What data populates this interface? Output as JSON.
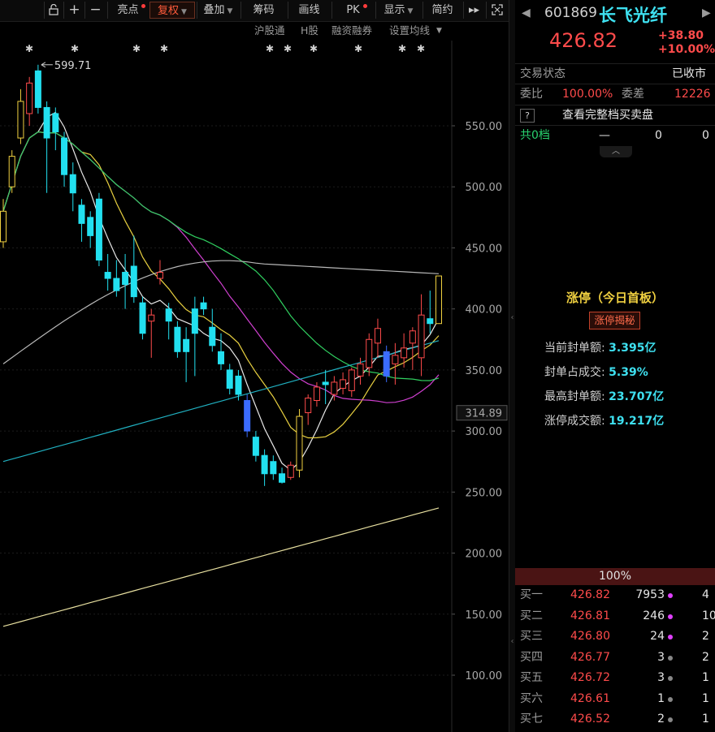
{
  "toolbar": {
    "items": [
      "亮点",
      "复权",
      "叠加",
      "筹码",
      "画线",
      "PK",
      "显示",
      "简约"
    ]
  },
  "sub_toolbar": [
    "沪股通",
    "H股",
    "融资融券",
    "设置均线"
  ],
  "chart": {
    "high_label": "599.71",
    "price_ticks": [
      "550.00",
      "500.00",
      "450.00",
      "400.00",
      "350.00",
      "314.89",
      "300.00",
      "250.00",
      "200.00",
      "150.00",
      "100.00"
    ]
  },
  "chart_data": {
    "type": "candlestick",
    "title": "",
    "y_ticks": [
      550,
      500,
      450,
      400,
      350,
      300,
      250,
      200,
      150,
      100
    ],
    "current_line": 314.89,
    "annotated_high": 599.71,
    "candles": [
      {
        "o": 455,
        "c": 480,
        "h": 490,
        "l": 450
      },
      {
        "o": 500,
        "c": 525,
        "h": 530,
        "l": 495
      },
      {
        "o": 540,
        "c": 570,
        "h": 580,
        "l": 535
      },
      {
        "o": 560,
        "c": 585,
        "h": 590,
        "l": 550
      },
      {
        "o": 595,
        "c": 565,
        "h": 600,
        "l": 560
      },
      {
        "o": 565,
        "c": 540,
        "h": 570,
        "l": 495
      },
      {
        "o": 560,
        "c": 545,
        "h": 565,
        "l": 530
      },
      {
        "o": 540,
        "c": 510,
        "h": 545,
        "l": 500
      },
      {
        "o": 510,
        "c": 495,
        "h": 520,
        "l": 480
      },
      {
        "o": 485,
        "c": 470,
        "h": 490,
        "l": 455
      },
      {
        "o": 475,
        "c": 460,
        "h": 480,
        "l": 450
      },
      {
        "o": 490,
        "c": 440,
        "h": 495,
        "l": 435
      },
      {
        "o": 430,
        "c": 425,
        "h": 445,
        "l": 415
      },
      {
        "o": 425,
        "c": 415,
        "h": 440,
        "l": 410
      },
      {
        "o": 430,
        "c": 420,
        "h": 445,
        "l": 400
      },
      {
        "o": 435,
        "c": 410,
        "h": 460,
        "l": 405
      },
      {
        "o": 405,
        "c": 380,
        "h": 410,
        "l": 375
      },
      {
        "o": 390,
        "c": 395,
        "h": 400,
        "l": 360
      },
      {
        "o": 425,
        "c": 430,
        "h": 440,
        "l": 420
      },
      {
        "o": 400,
        "c": 390,
        "h": 405,
        "l": 375
      },
      {
        "o": 385,
        "c": 365,
        "h": 390,
        "l": 360
      },
      {
        "o": 375,
        "c": 365,
        "h": 385,
        "l": 340
      },
      {
        "o": 400,
        "c": 380,
        "h": 410,
        "l": 345
      },
      {
        "o": 405,
        "c": 400,
        "h": 410,
        "l": 395
      },
      {
        "o": 385,
        "c": 370,
        "h": 400,
        "l": 365
      },
      {
        "o": 365,
        "c": 355,
        "h": 380,
        "l": 350
      },
      {
        "o": 350,
        "c": 335,
        "h": 355,
        "l": 330
      },
      {
        "o": 345,
        "c": 330,
        "h": 350,
        "l": 325
      },
      {
        "o": 325,
        "c": 300,
        "h": 330,
        "l": 295
      },
      {
        "o": 295,
        "c": 280,
        "h": 300,
        "l": 275
      },
      {
        "o": 280,
        "c": 265,
        "h": 285,
        "l": 255
      },
      {
        "o": 275,
        "c": 265,
        "h": 280,
        "l": 260
      },
      {
        "o": 265,
        "c": 258,
        "h": 270,
        "l": 257
      },
      {
        "o": 262,
        "c": 272,
        "h": 275,
        "l": 260
      },
      {
        "o": 268,
        "c": 312,
        "h": 318,
        "l": 262
      },
      {
        "o": 315,
        "c": 327,
        "h": 330,
        "l": 305
      },
      {
        "o": 325,
        "c": 336,
        "h": 340,
        "l": 320
      },
      {
        "o": 340,
        "c": 338,
        "h": 350,
        "l": 322
      },
      {
        "o": 330,
        "c": 340,
        "h": 345,
        "l": 325
      },
      {
        "o": 335,
        "c": 342,
        "h": 348,
        "l": 330
      },
      {
        "o": 333,
        "c": 350,
        "h": 352,
        "l": 328
      },
      {
        "o": 345,
        "c": 355,
        "h": 360,
        "l": 338
      },
      {
        "o": 352,
        "c": 375,
        "h": 380,
        "l": 345
      },
      {
        "o": 372,
        "c": 384,
        "h": 392,
        "l": 360
      },
      {
        "o": 365,
        "c": 345,
        "h": 370,
        "l": 340
      },
      {
        "o": 355,
        "c": 362,
        "h": 372,
        "l": 338
      },
      {
        "o": 360,
        "c": 368,
        "h": 380,
        "l": 352
      },
      {
        "o": 372,
        "c": 382,
        "h": 385,
        "l": 350
      },
      {
        "o": 360,
        "c": 395,
        "h": 412,
        "l": 345
      },
      {
        "o": 392,
        "c": 388,
        "h": 415,
        "l": 380
      },
      {
        "o": 388,
        "c": 427,
        "h": 427,
        "l": 388
      }
    ],
    "candle_colors": {
      "up": "#ff4b4b",
      "down": "#22e0f0",
      "up_yellow": "#f0d040",
      "down_blue": "#3b6cff"
    }
  },
  "header": {
    "code": "601869",
    "name": "长飞光纤",
    "price": "426.82",
    "change": "+38.80",
    "change_pct": "+10.00%"
  },
  "status": {
    "label": "交易状态",
    "value": "已收市",
    "weibi_label": "委比",
    "weibi_value": "100.00%",
    "weicha_label": "委差",
    "weicha_value": "12226",
    "full_book": "查看完整档买卖盘",
    "total_label": "共0档",
    "total_dash": "—",
    "total_v1": "0",
    "total_v2": "0"
  },
  "limit_up": {
    "title": "涨停（今日首板）",
    "button": "涨停揭秘",
    "lines": [
      {
        "k": "当前封单额:",
        "v": "3.395亿"
      },
      {
        "k": "封单占成交:",
        "v": "5.39%"
      },
      {
        "k": "最高封单额:",
        "v": "23.707亿"
      },
      {
        "k": "涨停成交额:",
        "v": "19.217亿"
      }
    ]
  },
  "order_book": {
    "bar": "100%",
    "rows": [
      {
        "n": "买一",
        "p": "426.82",
        "v": "7953",
        "x": "4",
        "dot": "#e040ff"
      },
      {
        "n": "买二",
        "p": "426.81",
        "v": "246",
        "x": "10",
        "dot": "#e040ff"
      },
      {
        "n": "买三",
        "p": "426.80",
        "v": "24",
        "x": "2",
        "dot": "#e040ff"
      },
      {
        "n": "买四",
        "p": "426.77",
        "v": "3",
        "x": "2",
        "dot": "#888888"
      },
      {
        "n": "买五",
        "p": "426.72",
        "v": "3",
        "x": "1",
        "dot": "#888888"
      },
      {
        "n": "买六",
        "p": "426.61",
        "v": "1",
        "x": "1",
        "dot": "#888888"
      },
      {
        "n": "买七",
        "p": "426.52",
        "v": "2",
        "x": "1",
        "dot": "#888888"
      }
    ]
  }
}
